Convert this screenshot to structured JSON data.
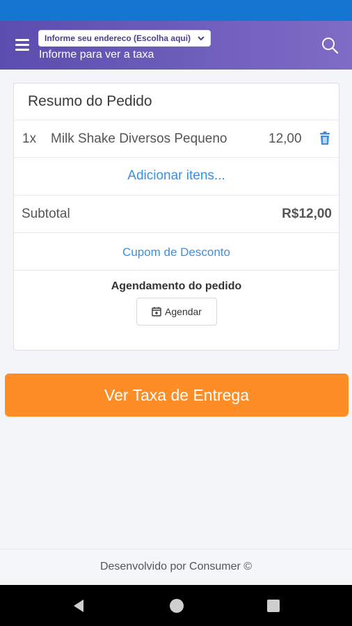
{
  "header": {
    "address_select": "Informe seu endereco (Escolha aqui)",
    "subtitle": "Informe para ver a taxa",
    "icons": {
      "menu": "hamburger-icon",
      "search": "search-icon",
      "chevron": "chevron-down-icon"
    }
  },
  "order": {
    "title": "Resumo do Pedido",
    "items": [
      {
        "qty": "1x",
        "name": "Milk Shake Diversos Pequeno",
        "price": "12,00"
      }
    ],
    "add_items": "Adicionar itens...",
    "subtotal_label": "Subtotal",
    "subtotal_value": "R$12,00",
    "coupon": "Cupom de Desconto",
    "schedule_label": "Agendamento do pedido",
    "schedule_button": "Agendar"
  },
  "delivery_button": "Ver Taxa de Entrega",
  "footer": "Desenvolvido por Consumer ©",
  "colors": {
    "status_bar": "#1576d1",
    "header_start": "#5b4dae",
    "header_end": "#7e6cc6",
    "accent_blue": "#3b8fdf",
    "cta_orange": "#fd8d24"
  }
}
